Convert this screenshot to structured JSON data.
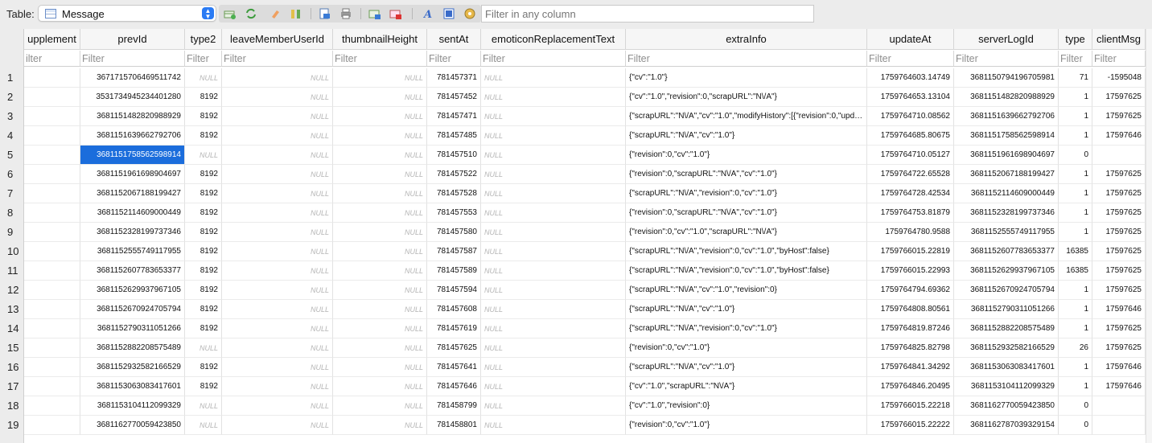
{
  "toolbar": {
    "table_label": "Table:",
    "table_name": "Message",
    "filter_placeholder": "Filter in any column",
    "tools": [
      "add-record-icon",
      "refresh-icon",
      "clear-icon",
      "columns-icon",
      "export-icon",
      "print-icon",
      "import-icon",
      "delete-records-icon",
      "italic-a-icon",
      "grid-icon",
      "settings-icon"
    ]
  },
  "columns": [
    {
      "label": "upplement",
      "filter": "ilter",
      "width": 70
    },
    {
      "label": "prevId",
      "filter": "Filter",
      "width": 130
    },
    {
      "label": "type2",
      "filter": "Filter",
      "width": 46
    },
    {
      "label": "leaveMemberUserId",
      "filter": "Filter",
      "width": 138
    },
    {
      "label": "thumbnailHeight",
      "filter": "Filter",
      "width": 117
    },
    {
      "label": "sentAt",
      "filter": "Filter",
      "width": 67
    },
    {
      "label": "emoticonReplacementText",
      "filter": "Filter",
      "width": 180
    },
    {
      "label": "extraInfo",
      "filter": "Filter",
      "width": 300
    },
    {
      "label": "updateAt",
      "filter": "Filter",
      "width": 108
    },
    {
      "label": "serverLogId",
      "filter": "Filter",
      "width": 130
    },
    {
      "label": "type",
      "filter": "Filter",
      "width": 42
    },
    {
      "label": "clientMsg",
      "filter": "Filter",
      "width": 66
    }
  ],
  "null_text": "NULL",
  "rows": [
    [
      "",
      "3671715706469511742",
      "NULL",
      "NULL",
      "NULL",
      "781457371",
      "NULL",
      "{\"cv\":\"1.0\"}",
      "1759764603.14749",
      "3681150794196705981",
      "71",
      "-1595048"
    ],
    [
      "",
      "3531734945234401280",
      "8192",
      "NULL",
      "NULL",
      "781457452",
      "NULL",
      "{\"cv\":\"1.0\",\"revision\":0,\"scrapURL\":\"N\\/A\"}",
      "1759764653.13104",
      "3681151482820988929",
      "1",
      "17597625"
    ],
    [
      "",
      "3681151482820988929",
      "8192",
      "NULL",
      "NULL",
      "781457471",
      "NULL",
      "{\"scrapURL\":\"N\\/A\",\"cv\":\"1.0\",\"modifyHistory\":[{\"revision\":0,\"updatedAt\":...",
      "1759764710.08562",
      "3681151639662792706",
      "1",
      "17597625"
    ],
    [
      "",
      "3681151639662792706",
      "8192",
      "NULL",
      "NULL",
      "781457485",
      "NULL",
      "{\"scrapURL\":\"N\\/A\",\"cv\":\"1.0\"}",
      "1759764685.80675",
      "3681151758562598914",
      "1",
      "17597646"
    ],
    [
      "",
      "3681151758562598914",
      "NULL",
      "NULL",
      "NULL",
      "781457510",
      "NULL",
      "{\"revision\":0,\"cv\":\"1.0\"}",
      "1759764710.05127",
      "3681151961698904697",
      "0",
      ""
    ],
    [
      "",
      "3681151961698904697",
      "8192",
      "NULL",
      "NULL",
      "781457522",
      "NULL",
      "{\"revision\":0,\"scrapURL\":\"N\\/A\",\"cv\":\"1.0\"}",
      "1759764722.65528",
      "3681152067188199427",
      "1",
      "17597625"
    ],
    [
      "",
      "3681152067188199427",
      "8192",
      "NULL",
      "NULL",
      "781457528",
      "NULL",
      "{\"scrapURL\":\"N\\/A\",\"revision\":0,\"cv\":\"1.0\"}",
      "1759764728.42534",
      "3681152114609000449",
      "1",
      "17597625"
    ],
    [
      "",
      "3681152114609000449",
      "8192",
      "NULL",
      "NULL",
      "781457553",
      "NULL",
      "{\"revision\":0,\"scrapURL\":\"N\\/A\",\"cv\":\"1.0\"}",
      "1759764753.81879",
      "3681152328199737346",
      "1",
      "17597625"
    ],
    [
      "",
      "3681152328199737346",
      "8192",
      "NULL",
      "NULL",
      "781457580",
      "NULL",
      "{\"revision\":0,\"cv\":\"1.0\",\"scrapURL\":\"N\\/A\"}",
      "1759764780.9588",
      "3681152555749117955",
      "1",
      "17597625"
    ],
    [
      "",
      "3681152555749117955",
      "8192",
      "NULL",
      "NULL",
      "781457587",
      "NULL",
      "{\"scrapURL\":\"N\\/A\",\"revision\":0,\"cv\":\"1.0\",\"byHost\":false}",
      "1759766015.22819",
      "3681152607783653377",
      "16385",
      "17597625"
    ],
    [
      "",
      "3681152607783653377",
      "8192",
      "NULL",
      "NULL",
      "781457589",
      "NULL",
      "{\"scrapURL\":\"N\\/A\",\"revision\":0,\"cv\":\"1.0\",\"byHost\":false}",
      "1759766015.22993",
      "3681152629937967105",
      "16385",
      "17597625"
    ],
    [
      "",
      "3681152629937967105",
      "8192",
      "NULL",
      "NULL",
      "781457594",
      "NULL",
      "{\"scrapURL\":\"N\\/A\",\"cv\":\"1.0\",\"revision\":0}",
      "1759764794.69362",
      "3681152670924705794",
      "1",
      "17597625"
    ],
    [
      "",
      "3681152670924705794",
      "8192",
      "NULL",
      "NULL",
      "781457608",
      "NULL",
      "{\"scrapURL\":\"N\\/A\",\"cv\":\"1.0\"}",
      "1759764808.80561",
      "3681152790311051266",
      "1",
      "17597646"
    ],
    [
      "",
      "3681152790311051266",
      "8192",
      "NULL",
      "NULL",
      "781457619",
      "NULL",
      "{\"scrapURL\":\"N\\/A\",\"revision\":0,\"cv\":\"1.0\"}",
      "1759764819.87246",
      "3681152882208575489",
      "1",
      "17597625"
    ],
    [
      "",
      "3681152882208575489",
      "NULL",
      "NULL",
      "NULL",
      "781457625",
      "NULL",
      "{\"revision\":0,\"cv\":\"1.0\"}",
      "1759764825.82798",
      "3681152932582166529",
      "26",
      "17597625"
    ],
    [
      "",
      "3681152932582166529",
      "8192",
      "NULL",
      "NULL",
      "781457641",
      "NULL",
      "{\"scrapURL\":\"N\\/A\",\"cv\":\"1.0\"}",
      "1759764841.34292",
      "3681153063083417601",
      "1",
      "17597646"
    ],
    [
      "",
      "3681153063083417601",
      "8192",
      "NULL",
      "NULL",
      "781457646",
      "NULL",
      "{\"cv\":\"1.0\",\"scrapURL\":\"N\\/A\"}",
      "1759764846.20495",
      "3681153104112099329",
      "1",
      "17597646"
    ],
    [
      "",
      "3681153104112099329",
      "NULL",
      "NULL",
      "NULL",
      "781458799",
      "NULL",
      "{\"cv\":\"1.0\",\"revision\":0}",
      "1759766015.22218",
      "3681162770059423850",
      "0",
      ""
    ],
    [
      "",
      "3681162770059423850",
      "NULL",
      "NULL",
      "NULL",
      "781458801",
      "NULL",
      "{\"revision\":0,\"cv\":\"1.0\"}",
      "1759766015.22222",
      "3681162787039329154",
      "0",
      ""
    ]
  ],
  "selected": {
    "row": 4,
    "col": 1
  }
}
